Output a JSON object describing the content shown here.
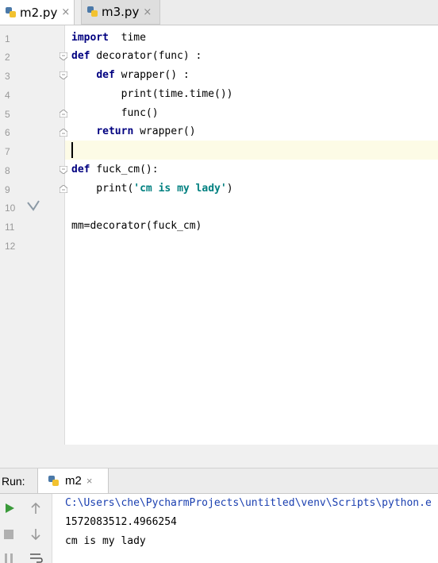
{
  "tabs": [
    {
      "label": "m2.py",
      "close": "×"
    },
    {
      "label": "m3.py",
      "close": "×"
    }
  ],
  "line_numbers": [
    "1",
    "2",
    "3",
    "4",
    "5",
    "6",
    "7",
    "8",
    "9",
    "10",
    "11",
    "12"
  ],
  "code": {
    "l1_kw": "import",
    "l1_rest": "  time",
    "l2_kw": "def",
    "l2_rest": " decorator(func) :",
    "l3_indent": "    ",
    "l3_kw": "def",
    "l3_rest": " wrapper() :",
    "l4": "        print(time.time())",
    "l5": "        func()",
    "l6_indent": "    ",
    "l6_kw": "return",
    "l6_rest": " wrapper()",
    "l8_kw": "def",
    "l8_rest": " fuck_cm():",
    "l9_pre": "    print(",
    "l9_str": "'cm is my lady'",
    "l9_post": ")",
    "l11": "mm=decorator(fuck_cm)"
  },
  "run": {
    "label": "Run:",
    "tab_label": "m2",
    "tab_close": "×",
    "output": [
      "C:\\Users\\che\\PycharmProjects\\untitled\\venv\\Scripts\\python.e",
      "1572083512.4966254",
      "cm is my lady"
    ]
  },
  "colors": {
    "keyword": "#000080",
    "string": "#008080",
    "run_green": "#3a9a3a"
  },
  "icons": [
    "python-file-icon",
    "close-icon",
    "fold-marker-icon",
    "checkmark-icon",
    "run-icon",
    "stop-icon",
    "up-arrow-icon",
    "down-arrow-icon",
    "pause-icon",
    "soft-wrap-icon"
  ]
}
